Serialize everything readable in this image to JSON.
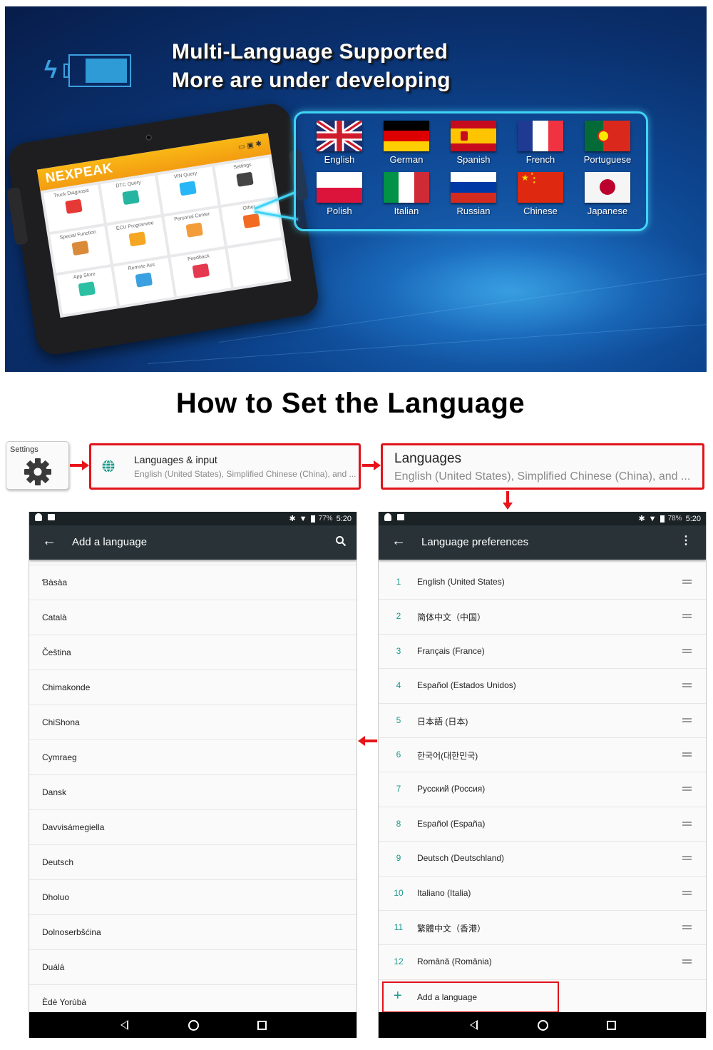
{
  "banner": {
    "title_line1": "Multi-Language Supported",
    "title_line2": "More are under developing",
    "tablet": {
      "brand": "NEXPEAK",
      "apps": [
        {
          "label": "Truck Diagnosis",
          "color": "#e53935"
        },
        {
          "label": "DTC Query",
          "color": "#26b5a0"
        },
        {
          "label": "VIN Query",
          "color": "#29b6f6"
        },
        {
          "label": "Settings",
          "color": "#444444"
        },
        {
          "label": "Special Function",
          "color": "#d98b3a"
        },
        {
          "label": "ECU Programme",
          "color": "#f5a623"
        },
        {
          "label": "Personal Center",
          "color": "#f39c3a"
        },
        {
          "label": "Other",
          "color": "#f26b22"
        },
        {
          "label": "App Store",
          "color": "#2bbfa4"
        },
        {
          "label": "Remote Ass",
          "color": "#3aa0e0"
        },
        {
          "label": "Feedback",
          "color": "#e53950"
        },
        {
          "label": "",
          "color": "#ffffff"
        }
      ]
    },
    "languages": [
      {
        "label": "English",
        "flag": "uk"
      },
      {
        "label": "German",
        "flag": "de"
      },
      {
        "label": "Spanish",
        "flag": "es"
      },
      {
        "label": "French",
        "flag": "fr"
      },
      {
        "label": "Portuguese",
        "flag": "pt"
      },
      {
        "label": "Polish",
        "flag": "pl"
      },
      {
        "label": "Italian",
        "flag": "it"
      },
      {
        "label": "Russian",
        "flag": "ru"
      },
      {
        "label": "Chinese",
        "flag": "cn"
      },
      {
        "label": "Japanese",
        "flag": "jp"
      }
    ]
  },
  "howto": {
    "title": "How to Set the Language",
    "step1": {
      "label": "Settings",
      "icon": "gear-icon"
    },
    "step2": {
      "title": "Languages & input",
      "subtitle": "English (United States), Simplified Chinese (China), and ...",
      "icon": "globe-icon"
    },
    "step3": {
      "title": "Languages",
      "subtitle": "English (United States), Simplified Chinese (China), and ..."
    }
  },
  "add_language_screen": {
    "status": {
      "battery": "77%",
      "time": "5:20"
    },
    "title": "Add a language",
    "items": [
      "Ɓàsàa",
      "Català",
      "Čeština",
      "Chimakonde",
      "ChiShona",
      "Cymraeg",
      "Dansk",
      "Davvisámegiella",
      "Deutsch",
      "Dholuo",
      "Dolnoserbšćina",
      "Duálá",
      "Èdè Yorùbá"
    ]
  },
  "preferences_screen": {
    "status": {
      "battery": "78%",
      "time": "5:20"
    },
    "title": "Language preferences",
    "items": [
      {
        "num": "1",
        "label": "English (United States)"
      },
      {
        "num": "2",
        "label": "简体中文（中国）"
      },
      {
        "num": "3",
        "label": "Français (France)"
      },
      {
        "num": "4",
        "label": "Español (Estados Unidos)"
      },
      {
        "num": "5",
        "label": "日本語 (日本)"
      },
      {
        "num": "6",
        "label": "한국어(대한민국)"
      },
      {
        "num": "7",
        "label": "Русский (Россия)"
      },
      {
        "num": "8",
        "label": "Español (España)"
      },
      {
        "num": "9",
        "label": "Deutsch (Deutschland)"
      },
      {
        "num": "10",
        "label": "Italiano (Italia)"
      },
      {
        "num": "11",
        "label": "繁體中文（香港）"
      },
      {
        "num": "12",
        "label": "Română (România)"
      }
    ],
    "add_label": "Add a language"
  },
  "colors": {
    "accent_teal": "#1b9a8c",
    "highlight_red": "#e0141a",
    "appbar": "#283237",
    "statusbar": "#1b2226"
  }
}
